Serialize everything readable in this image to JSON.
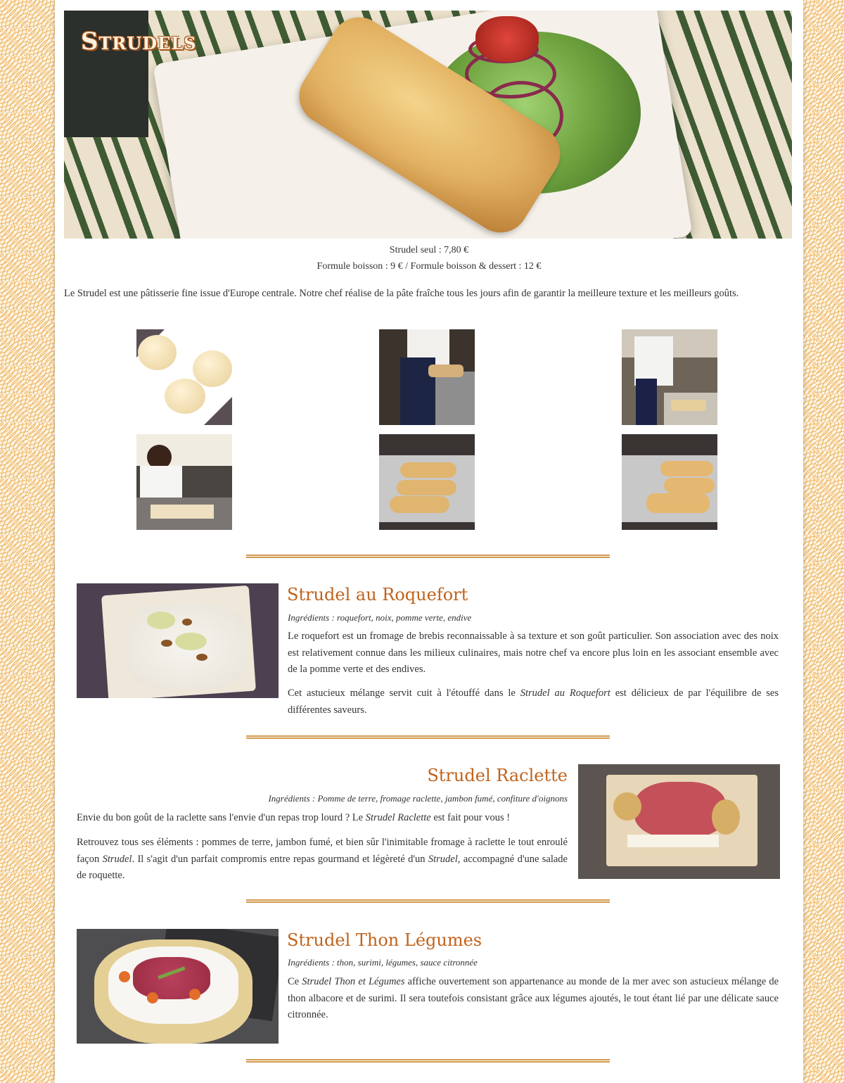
{
  "page": {
    "title": "Strudels",
    "price_single": "Strudel seul : 7,80 €",
    "price_formula": "Formule boisson : 9 € / Formule boisson & dessert : 12 €",
    "intro": "Le Strudel est une pâtisserie fine issue d'Europe centrale. Notre chef réalise de la pâte fraîche tous les jours afin de garantir la meilleure texture et les meilleurs goûts."
  },
  "gallery": [
    {
      "name": "dough-balls-photo"
    },
    {
      "name": "chef-kneading-photo"
    },
    {
      "name": "chef-rolling-dough-photo"
    },
    {
      "name": "chef-preparing-strudels-photo"
    },
    {
      "name": "strudels-on-tray-photo"
    },
    {
      "name": "strudels-baking-photo"
    }
  ],
  "recipes": [
    {
      "title": "Strudel au Roquefort",
      "ingredients": "Ingrédients : roquefort, noix, pomme verte, endive",
      "para1": "Le roquefort est un fromage de brebis reconnaissable à sa texture et son goût particulier. Son association avec des noix est relativement connue dans les milieux culinaires, mais notre chef va encore plus loin en les associant ensemble avec de la pomme verte et des endives.",
      "para2_before": "Cet astucieux mélange servit cuit à l'étouffé dans le ",
      "para2_em": "Strudel au Roquefort",
      "para2_after": " est délicieux de par l'équilibre de ses différentes saveurs."
    },
    {
      "title": "Strudel Raclette",
      "ingredients": "Ingrédients : Pomme de terre, fromage raclette, jambon fumé, confiture d'oignons",
      "para1_before": "Envie du bon goût de la raclette sans l'envie d'un repas trop lourd ? Le ",
      "para1_em": "Strudel Raclette",
      "para1_after": " est fait pour vous !",
      "para2_a": "Retrouvez tous ses éléments : pommes de terre, jambon fumé, et bien sûr l'inimitable fromage à raclette le tout enroulé façon ",
      "para2_em1": "Strudel",
      "para2_b": ". Il s'agit d'un parfait compromis entre repas gourmand et légèreté d'un ",
      "para2_em2": "Strudel",
      "para2_c": ", accompagné d'une salade de roquette."
    },
    {
      "title": "Strudel Thon Légumes",
      "ingredients": "Ingrédients : thon, surimi, légumes, sauce citronnée",
      "para1_before": "Ce ",
      "para1_em": "Strudel Thon et Légumes",
      "para1_after": " affiche ouvertement son appartenance au monde de la mer avec son astucieux mélange de thon albacore et de surimi. Il sera toutefois consistant grâce aux légumes ajoutés, le tout étant lié par une délicate sauce citronnée."
    }
  ]
}
